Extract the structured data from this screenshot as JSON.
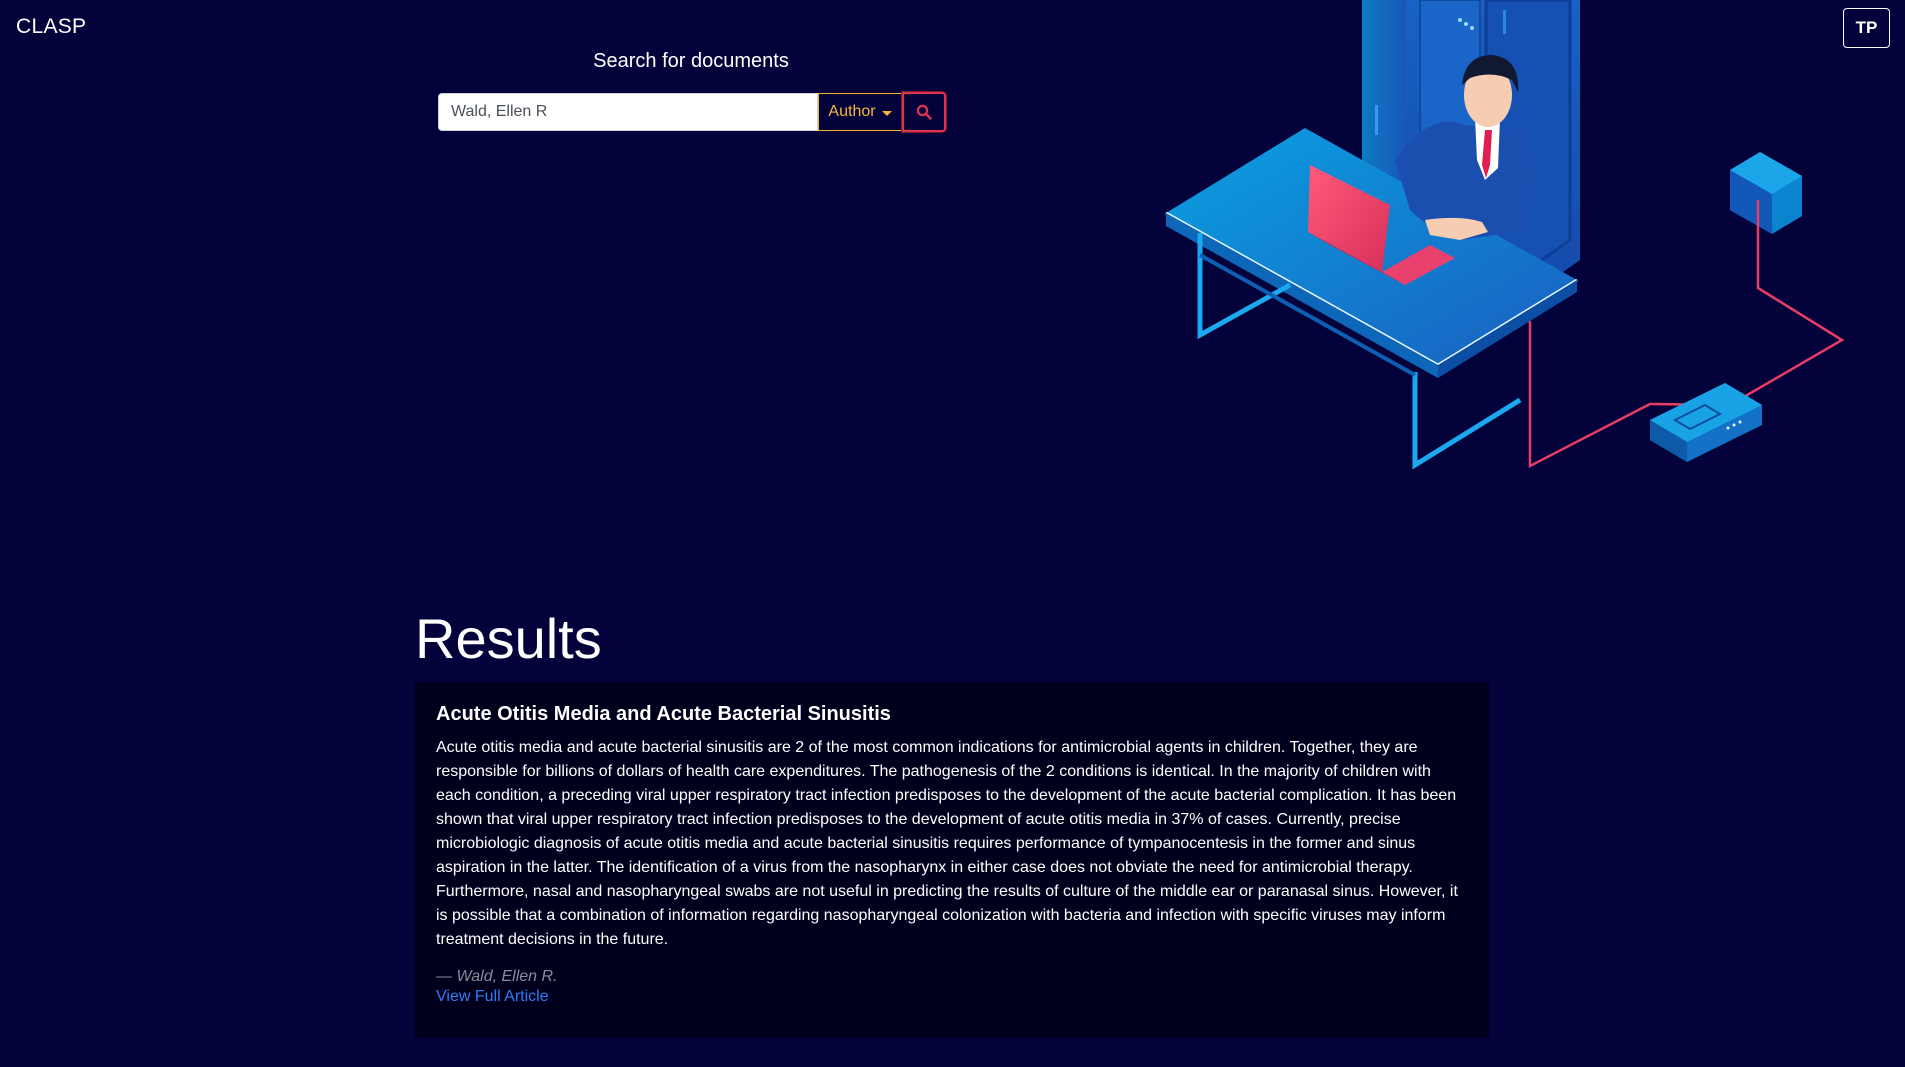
{
  "nav": {
    "brand": "CLASP",
    "user_initials": "TP"
  },
  "search": {
    "title": "Search for documents",
    "query_value": "Wald, Ellen R",
    "filter_label": "Author",
    "search_icon": "search-icon"
  },
  "results": {
    "heading": "Results",
    "items": [
      {
        "title": "Acute Otitis Media and Acute Bacterial Sinusitis",
        "abstract": "Acute otitis media and acute bacterial sinusitis are 2 of the most common indications for antimicrobial agents in children. Together, they are responsible for billions of dollars of health care expenditures. The pathogenesis of the 2 conditions is identical. In the majority of children with each condition, a preceding viral upper respiratory tract infection predisposes to the development of the acute bacterial complication. It has been shown that viral upper respiratory tract infection predisposes to the development of acute otitis media in 37% of cases. Currently, precise microbiologic diagnosis of acute otitis media and acute bacterial sinusitis requires performance of tympanocentesis in the former and sinus aspiration in the latter. The identification of a virus from the nasopharynx in either case does not obviate the need for antimicrobial therapy. Furthermore, nasal and nasopharyngeal swabs are not useful in predicting the results of culture of the middle ear or paranasal sinus. However, it is possible that a combination of information regarding nasopharyngeal colonization with bacteria and infection with specific viruses may inform treatment decisions in the future.",
        "author": "— Wald, Ellen R.",
        "link_label": "View Full Article"
      }
    ]
  },
  "colors": {
    "background": "#03023a",
    "card_background": "#01001c",
    "filter_accent": "#f6b73c",
    "search_button_accent": "#e0334f",
    "link": "#2f7cf6"
  }
}
